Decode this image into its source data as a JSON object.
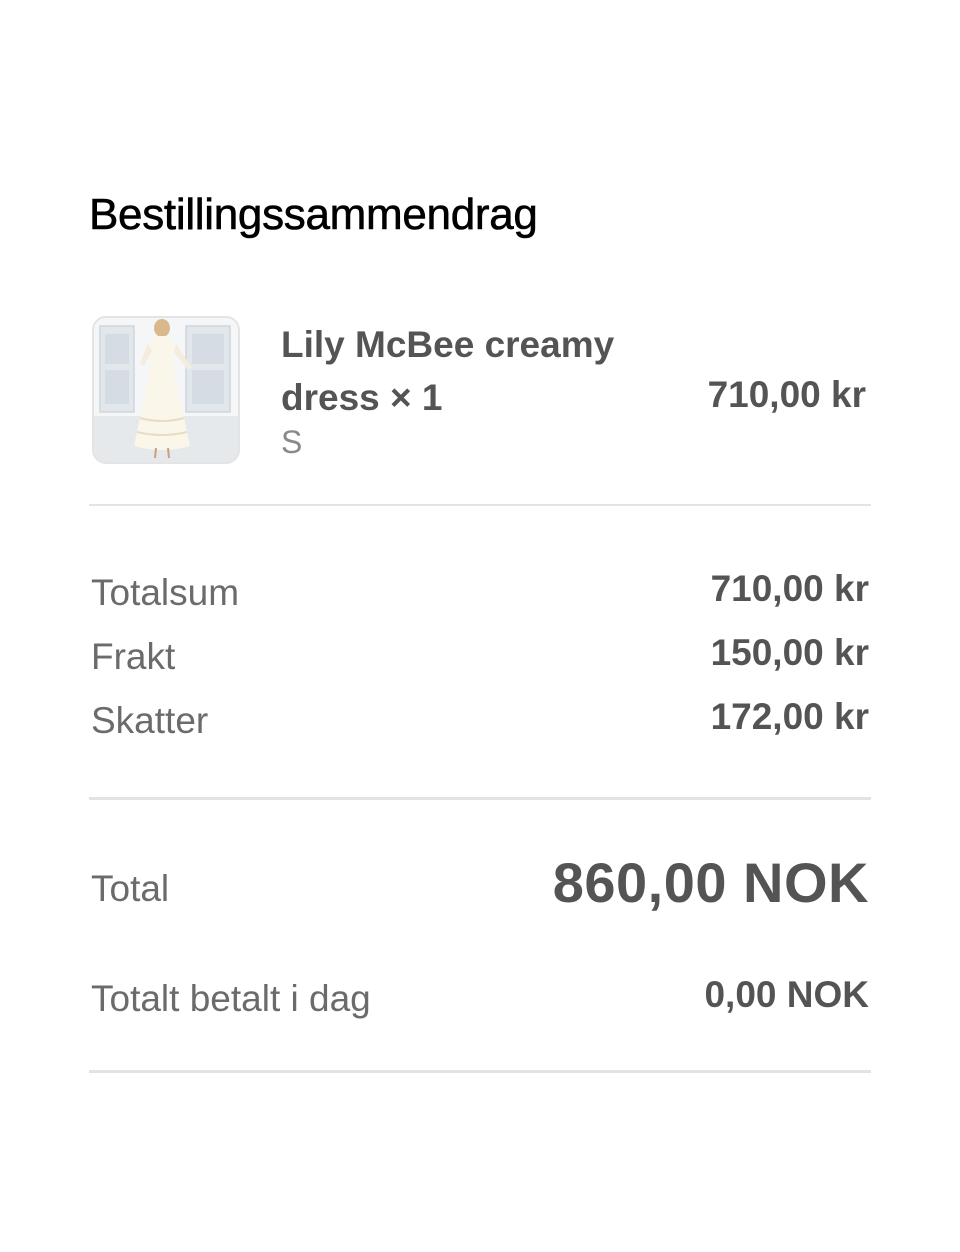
{
  "summary": {
    "title": "Bestillingssammendrag"
  },
  "item": {
    "image": "product-photo-dress",
    "name": "Lily McBee creamy dress × 1",
    "variant": "S",
    "price": "710,00 kr"
  },
  "costs": [
    {
      "label": "Totalsum",
      "value": "710,00 kr"
    },
    {
      "label": "Frakt",
      "value": "150,00 kr"
    },
    {
      "label": "Skatter",
      "value": "172,00 kr"
    }
  ],
  "total": {
    "label": "Total",
    "value": "860,00 NOK"
  },
  "paid_today": {
    "label": "Totalt betalt i dag",
    "value": "0,00 NOK"
  }
}
